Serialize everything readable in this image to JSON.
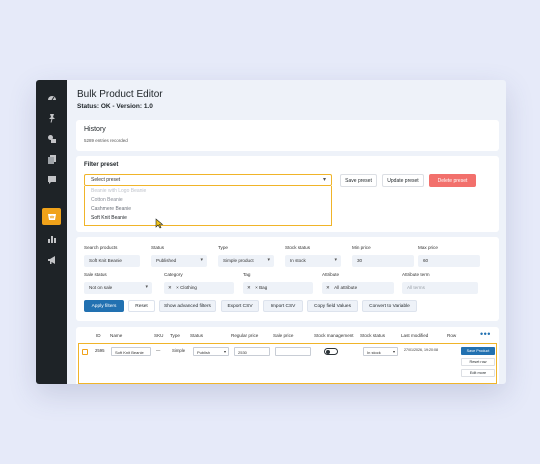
{
  "colors": {
    "page_bg": "#e6eaf9",
    "sidebar_bg": "#1e2327",
    "accent": "#f0a21a",
    "primary": "#2271b1",
    "danger": "#f2706c"
  },
  "sidebar": {
    "items": [
      {
        "icon": "dashboard-icon",
        "active": false
      },
      {
        "icon": "pin-icon",
        "active": false
      },
      {
        "icon": "media-icon",
        "active": false
      },
      {
        "icon": "pages-icon",
        "active": false
      },
      {
        "icon": "comments-icon",
        "active": false
      },
      {
        "icon": "woocommerce-icon",
        "active": true
      },
      {
        "icon": "analytics-icon",
        "active": false
      },
      {
        "icon": "marketing-icon",
        "active": false
      }
    ]
  },
  "header": {
    "title": "Bulk Product Editor",
    "status": "Status: OK - Version: 1.0"
  },
  "history": {
    "title": "History",
    "subtitle": "5289 entries recorded"
  },
  "filter_preset": {
    "title": "Filter preset",
    "select_value": "Select preset",
    "options": [
      "Beanie with Logo Beanie",
      "Cotton Beanie",
      "Cashmere Beanie",
      "Soft Knit Beanie"
    ],
    "hovered_option": "Soft Knit Beanie",
    "save_label": "Save preset",
    "update_label": "Update preset",
    "delete_label": "Delete preset"
  },
  "filters": {
    "search_products": {
      "label": "Search products",
      "value": "Soft Knit Beanie"
    },
    "status": {
      "label": "Status",
      "value": "Published"
    },
    "type": {
      "label": "Type",
      "value": "Simple product"
    },
    "stock_status": {
      "label": "Stock status",
      "value": "In stock"
    },
    "min_price": {
      "label": "Min price",
      "value": "30"
    },
    "max_price": {
      "label": "Max price",
      "value": "60"
    },
    "sale_status": {
      "label": "Sale status",
      "value": "Not on sale"
    },
    "category": {
      "label": "Category",
      "value": "Clothing"
    },
    "tag": {
      "label": "Tag",
      "value": "Bag"
    },
    "attribute": {
      "label": "Attribute",
      "value": "All attribute"
    },
    "attribute_term": {
      "label": "Attribute term",
      "placeholder": "All terms"
    }
  },
  "filter_buttons": {
    "apply": "Apply filters",
    "reset": "Reset",
    "advanced": "Show advanced filters",
    "export": "Export CSV",
    "import": "Import CSV",
    "copy_field": "Copy field Values",
    "convert": "Convert to Variable"
  },
  "table": {
    "columns": [
      "ID",
      "Name",
      "SKU",
      "Type",
      "Status",
      "Regular price",
      "Sale price",
      "Stock management",
      "Stock status",
      "Last modified",
      "Row"
    ],
    "row": {
      "id": "2595",
      "name": "Soft Knit Beanie",
      "sku": "—",
      "type": "Simple",
      "status": "Publish",
      "regular_price": "2530",
      "sale_price": "",
      "stock_status": "In stock",
      "last_modified": "27/01/2026, 19:20:08",
      "save_label": "Save Product",
      "reset_label": "Reset row",
      "edit_label": "Edit more"
    }
  }
}
